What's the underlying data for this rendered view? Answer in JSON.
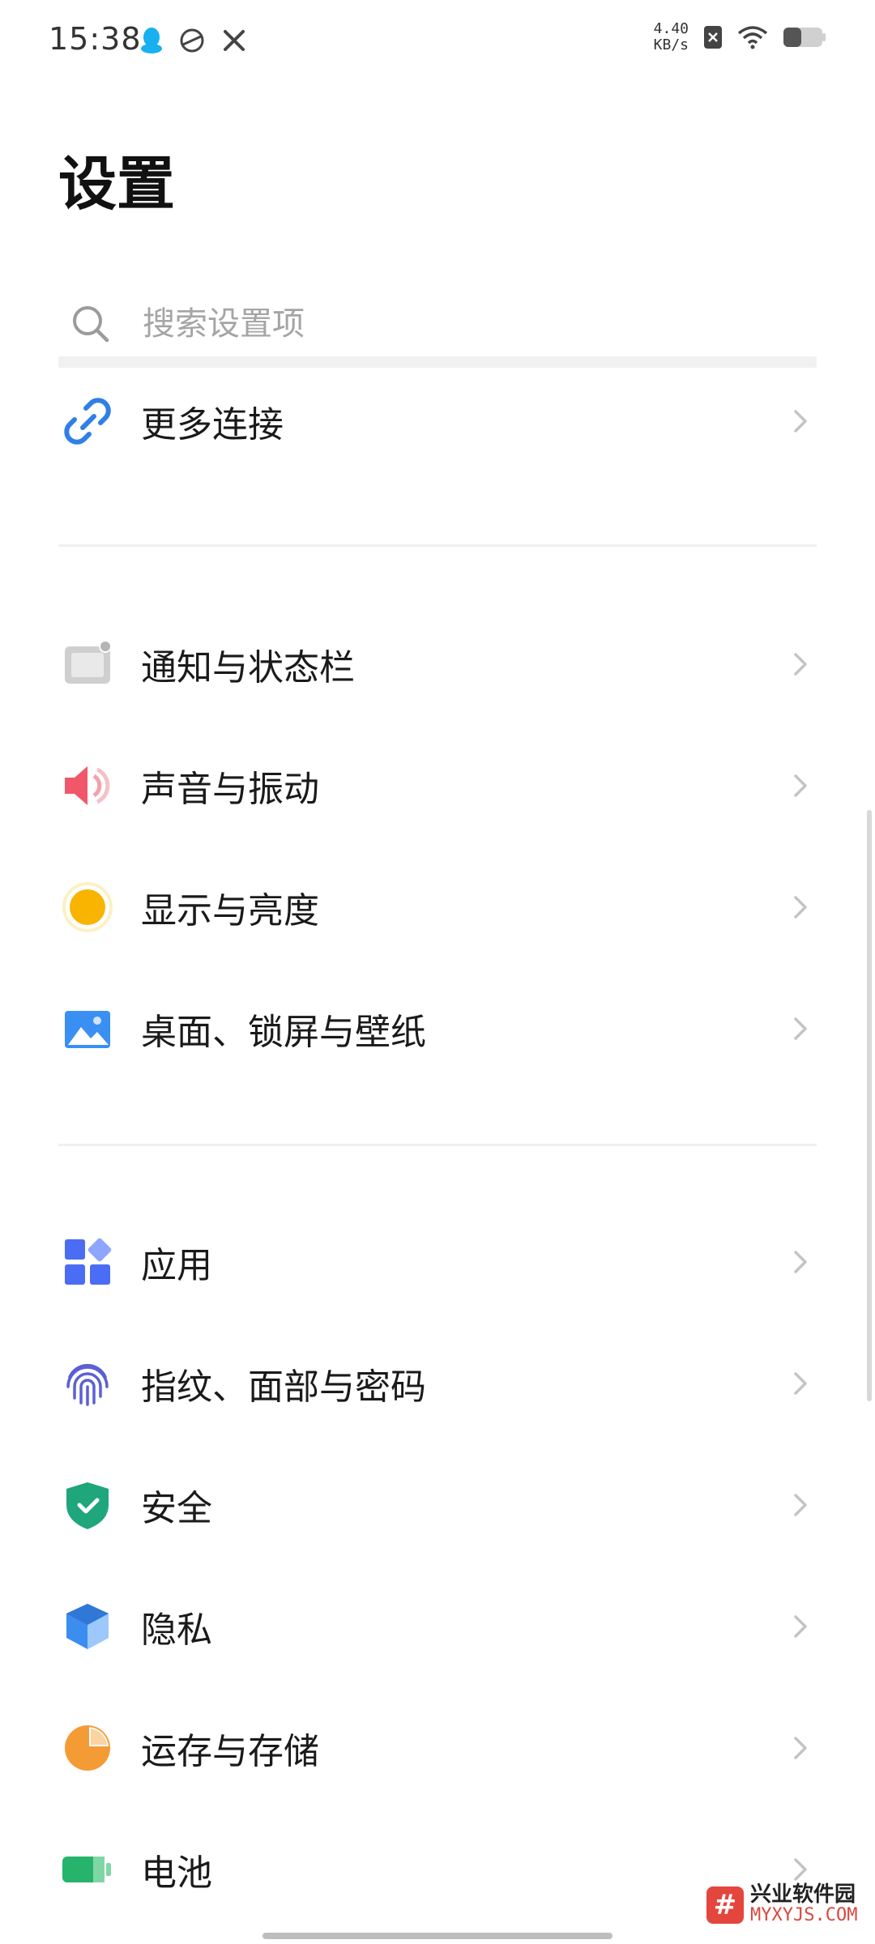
{
  "status_bar": {
    "time": "15:38",
    "left_icons": [
      "qq-icon",
      "bowl-icon",
      "tools-icon"
    ],
    "net_speed_value": "4.40",
    "net_speed_unit": "KB/s"
  },
  "page": {
    "title": "设置"
  },
  "search": {
    "placeholder": "搜索设置项"
  },
  "groups": [
    {
      "items": [
        {
          "label": "更多连接",
          "icon": "link-icon",
          "color": "#2f7fe6"
        }
      ]
    },
    {
      "items": [
        {
          "label": "通知与状态栏",
          "icon": "notification-icon",
          "color": "#b9b9b9"
        },
        {
          "label": "声音与振动",
          "icon": "speaker-icon",
          "color": "#f0586a"
        },
        {
          "label": "显示与亮度",
          "icon": "brightness-icon",
          "color": "#f8b400"
        },
        {
          "label": "桌面、锁屏与壁纸",
          "icon": "wallpaper-icon",
          "color": "#3a8ff2"
        }
      ]
    },
    {
      "items": [
        {
          "label": "应用",
          "icon": "apps-icon",
          "color": "#4b6df3"
        },
        {
          "label": "指纹、面部与密码",
          "icon": "fingerprint-icon",
          "color": "#5b5fd6"
        },
        {
          "label": "安全",
          "icon": "shield-icon",
          "color": "#1fa67a"
        },
        {
          "label": "隐私",
          "icon": "privacy-cube-icon",
          "color": "#3b8df0"
        },
        {
          "label": "运存与存储",
          "icon": "storage-pie-icon",
          "color": "#f59b35"
        },
        {
          "label": "电池",
          "icon": "battery-icon",
          "color": "#26b36b"
        }
      ]
    }
  ],
  "watermark": {
    "badge": "#",
    "title": "兴业软件园",
    "url": "MYXYJS.COM"
  }
}
